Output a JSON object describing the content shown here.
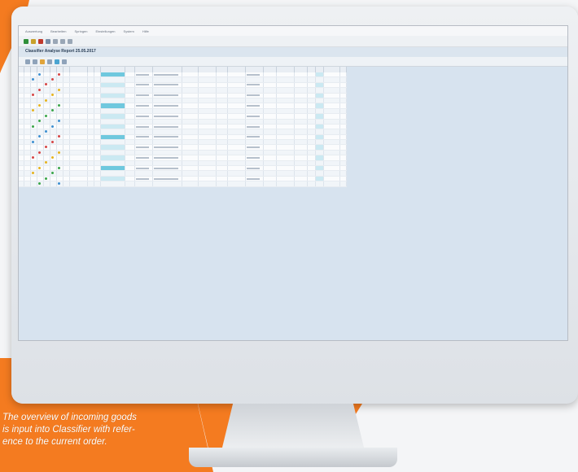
{
  "caption": {
    "line1": "The overview of incoming goods",
    "line2": "is input into Classifier with refer-",
    "line3": "ence to the current order."
  },
  "app": {
    "menu": [
      "Auswertung",
      "Bearbeiten",
      "Springen",
      "Einstellungen",
      "System",
      "Hilfe"
    ],
    "report_title": "Classifier Analyse Report 25.05.2017",
    "toolbar1_icons": [
      "back-icon",
      "exit-icon",
      "cancel-icon",
      "save-icon",
      "print-icon",
      "find-icon",
      "settings-icon"
    ],
    "toolbar2_icons": [
      "sort-icon",
      "filter-icon",
      "sum-icon",
      "export-icon",
      "layout-icon",
      "refresh-icon"
    ],
    "colors": {
      "accent": "#f47b20",
      "header_blue": "#dbe5ef",
      "highlight": "#6fc8de",
      "selection": "#cbe9f2"
    }
  },
  "table": {
    "rows": 22
  }
}
